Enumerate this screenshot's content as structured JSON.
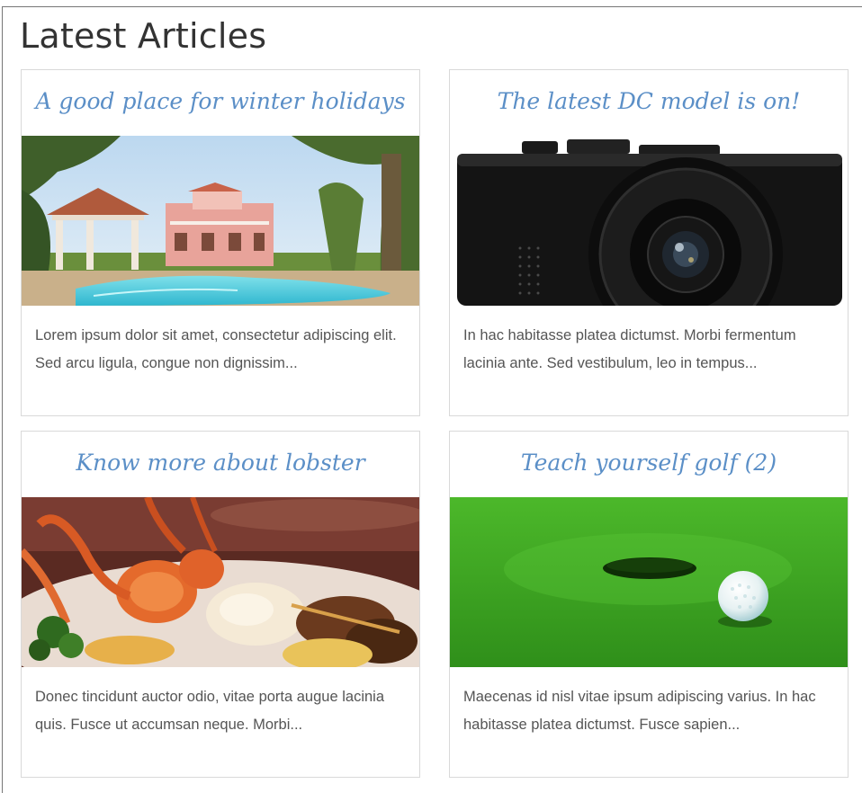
{
  "section": {
    "title": "Latest Articles"
  },
  "articles": [
    {
      "title": "A good place for winter holidays",
      "excerpt": "Lorem ipsum dolor sit amet, consectetur adipiscing elit. Sed arcu ligula, congue non dignissim...",
      "image_subject": "resort-pool"
    },
    {
      "title": "The latest DC model is on!",
      "excerpt": "In hac habitasse platea dictumst. Morbi fermentum lacinia ante. Sed vestibulum, leo in tempus...",
      "image_subject": "camera"
    },
    {
      "title": "Know more about lobster",
      "excerpt": "Donec tincidunt auctor odio, vitae porta augue lacinia quis. Fusce ut accumsan neque. Morbi...",
      "image_subject": "lobster-dish"
    },
    {
      "title": "Teach yourself golf (2)",
      "excerpt": "Maecenas id nisl vitae ipsum adipiscing varius. In hac habitasse platea dictumst. Fusce sapien...",
      "image_subject": "golf-ball"
    }
  ],
  "colors": {
    "title_link": "#5b8fc7",
    "heading": "#333333",
    "body_text": "#555555",
    "card_border": "#d9d9d9"
  }
}
